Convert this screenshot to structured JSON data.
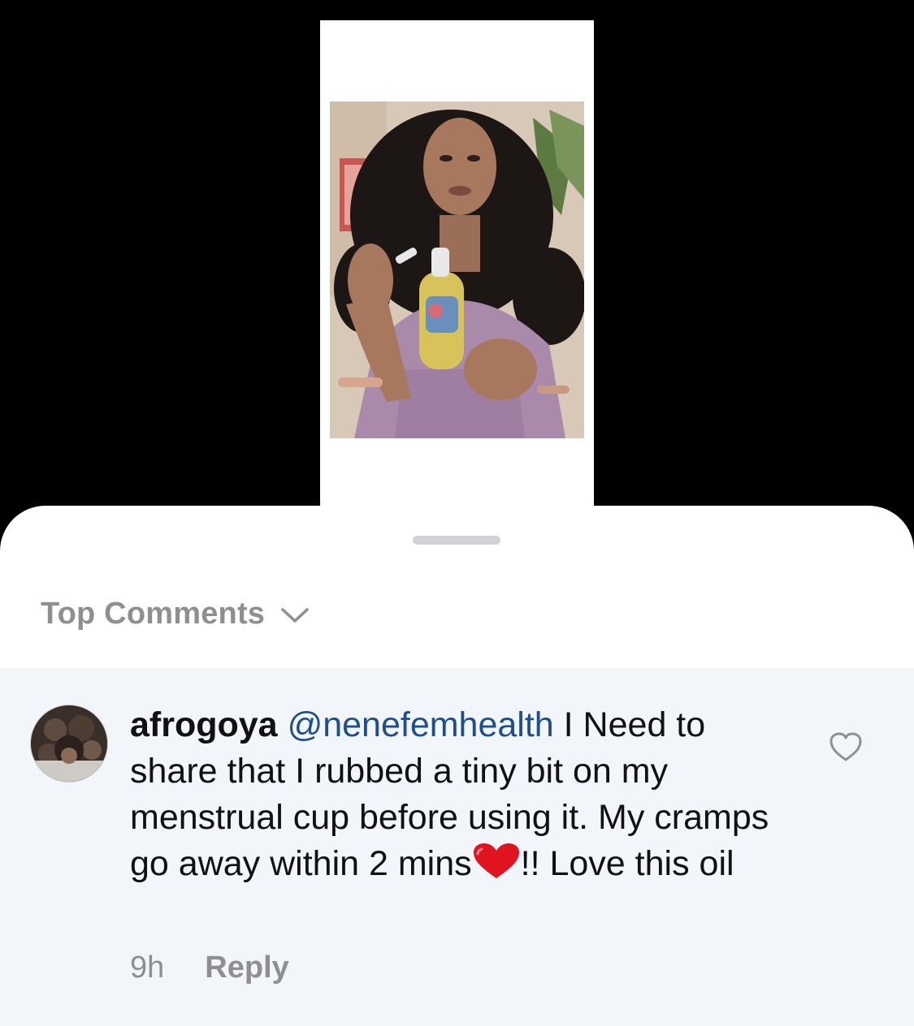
{
  "sheet": {
    "sort_label": "Top Comments"
  },
  "comment": {
    "username": "afrogoya",
    "mention": "@nenefemhealth",
    "text_part1": " I Need to share that I rubbed a tiny bit on my menstrual cup before using it. My cramps go away within 2 mins",
    "text_part2": "!! Love this oil",
    "timestamp": "9h",
    "reply_label": "Reply"
  },
  "icons": {
    "sort": "chevron-down-icon",
    "like": "heart-outline-icon",
    "emoji": "red-heart-emoji"
  },
  "colors": {
    "mention": "#1f4e8c",
    "secondary_text": "#8e8e93",
    "comment_bg": "#f2f5fa",
    "heart_emoji": "#e0141e"
  }
}
